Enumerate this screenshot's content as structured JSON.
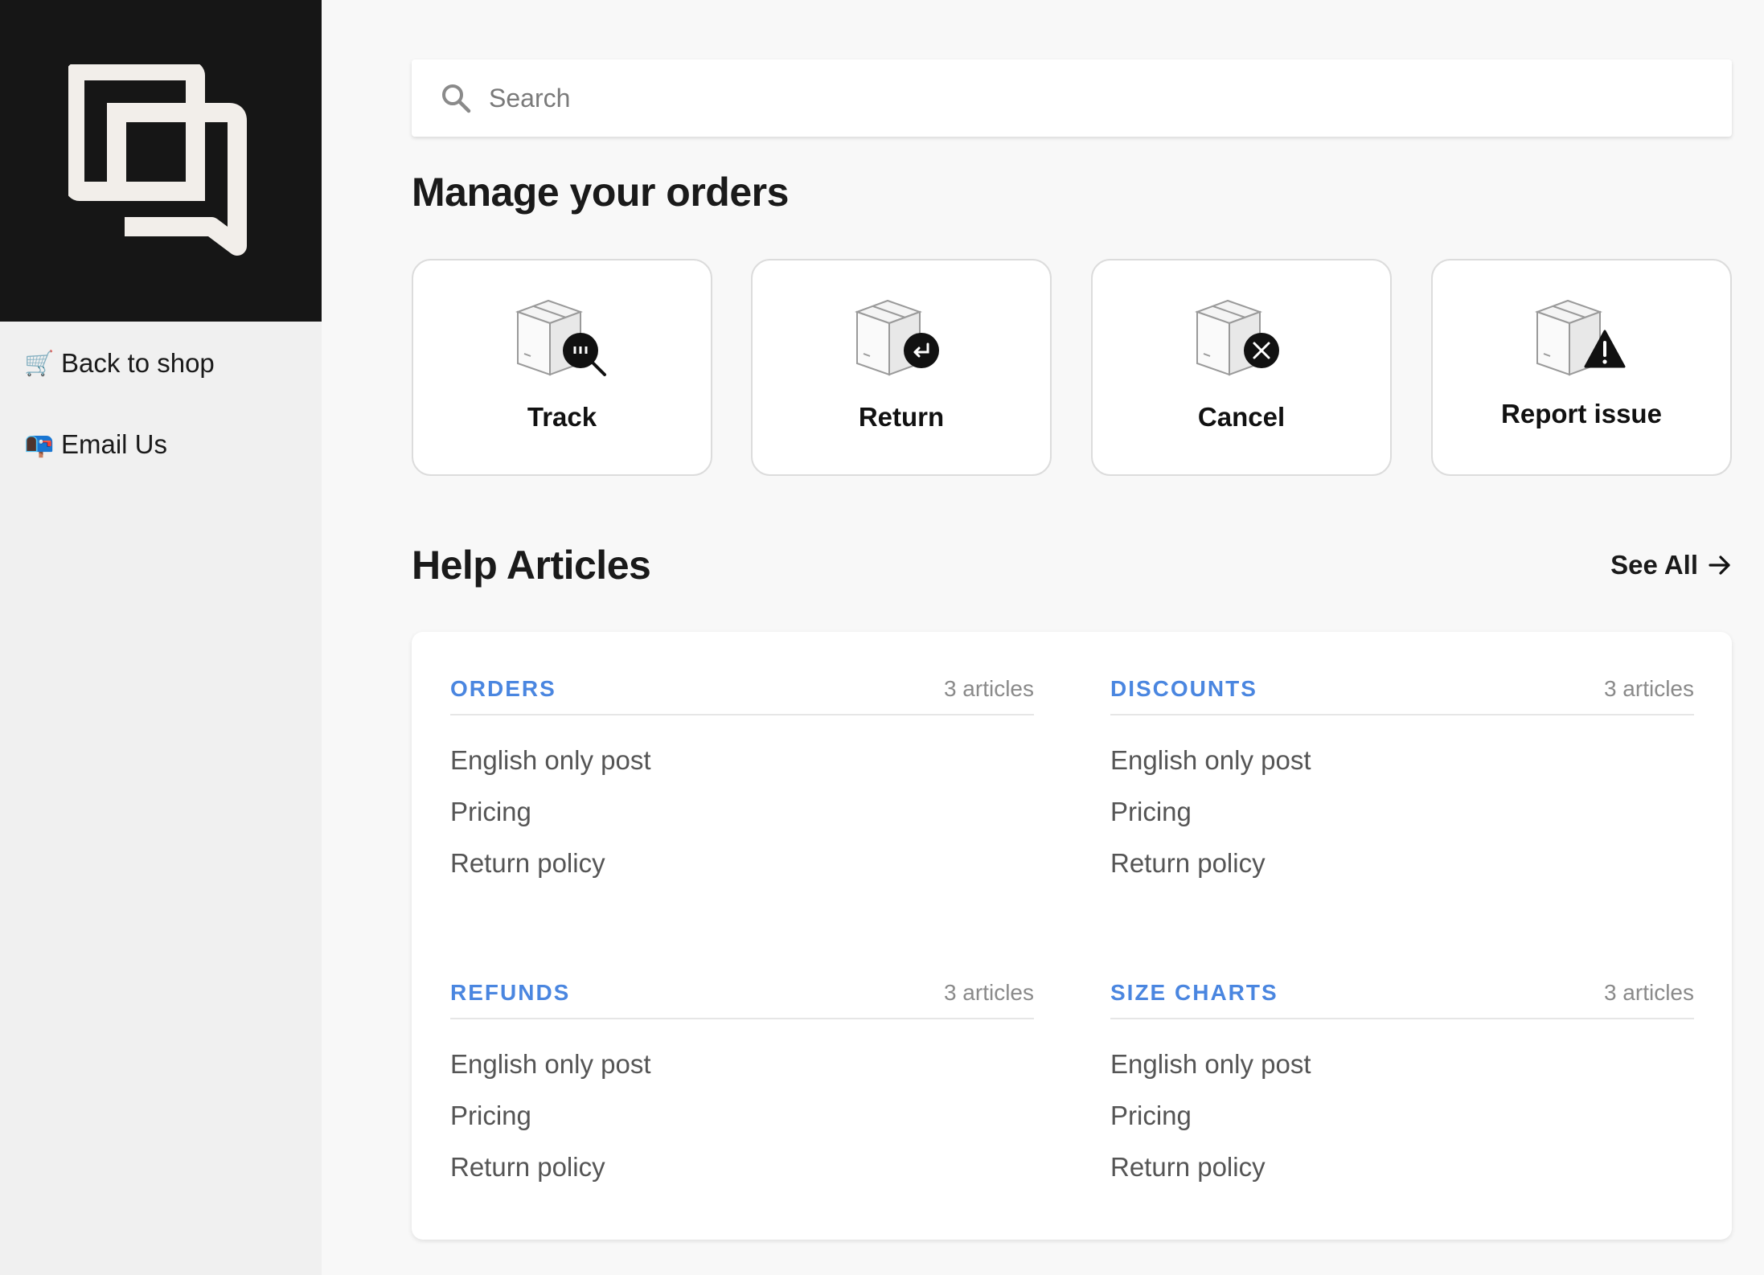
{
  "sidebar": {
    "items": [
      {
        "emoji": "🛒",
        "label": "Back to shop"
      },
      {
        "emoji": "📭",
        "label": "Email Us"
      }
    ]
  },
  "search": {
    "placeholder": "Search"
  },
  "orders": {
    "title": "Manage your orders",
    "actions": [
      {
        "label": "Track",
        "icon": "package-track-icon"
      },
      {
        "label": "Return",
        "icon": "package-return-icon"
      },
      {
        "label": "Cancel",
        "icon": "package-cancel-icon"
      },
      {
        "label": "Report issue",
        "icon": "package-report-icon"
      }
    ]
  },
  "help": {
    "title": "Help Articles",
    "see_all": "See All",
    "categories": [
      {
        "title": "ORDERS",
        "count": "3 articles",
        "articles": [
          "English only post",
          "Pricing",
          "Return policy"
        ]
      },
      {
        "title": "DISCOUNTS",
        "count": "3 articles",
        "articles": [
          "English only post",
          "Pricing",
          "Return policy"
        ]
      },
      {
        "title": "REFUNDS",
        "count": "3 articles",
        "articles": [
          "English only post",
          "Pricing",
          "Return policy"
        ]
      },
      {
        "title": "SIZE CHARTS",
        "count": "3 articles",
        "articles": [
          "English only post",
          "Pricing",
          "Return policy"
        ]
      }
    ]
  },
  "colors": {
    "sidebar_bg": "#f0f0f0",
    "logo_bg": "#161616",
    "accent": "#4a86e0",
    "page_bg": "#f8f8f8"
  }
}
